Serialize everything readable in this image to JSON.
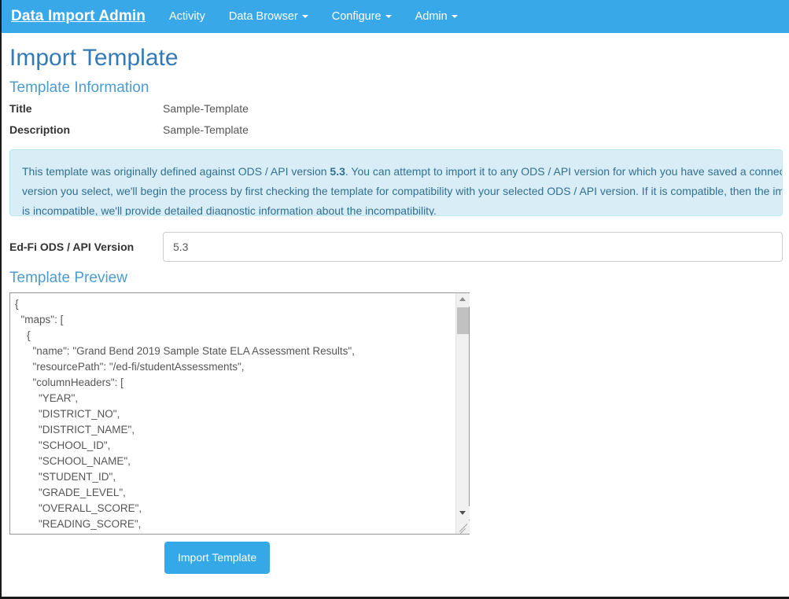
{
  "navbar": {
    "brand": "Data Import Admin",
    "items": [
      {
        "label": "Activity",
        "has_caret": false
      },
      {
        "label": "Data Browser",
        "has_caret": true
      },
      {
        "label": "Configure",
        "has_caret": true
      },
      {
        "label": "Admin",
        "has_caret": true
      }
    ]
  },
  "page": {
    "title": "Import Template",
    "section_template_information": "Template Information",
    "section_template_preview": "Template Preview"
  },
  "template_information": {
    "title_label": "Title",
    "title_value": "Sample-Template",
    "description_label": "Description",
    "description_value": "Sample-Template"
  },
  "alert": {
    "line1_pre": "This template was originally defined against ODS / API version ",
    "line1_version": "5.3",
    "line1_post": ". You can attempt to import it to any ODS / API version for which you have saved a connection. Whatever",
    "line2": "version you select, we'll begin the process by first checking the template for compatibility with your selected ODS / API version. If it is compatible, then the import will proceed. If it",
    "line3": "is incompatible, we'll provide detailed diagnostic information about the incompatibility."
  },
  "version_field": {
    "label": "Ed-Fi ODS / API Version",
    "value": "5.3",
    "options": [
      "5.3"
    ]
  },
  "preview": {
    "content": "{\n  \"maps\": [\n    {\n      \"name\": \"Grand Bend 2019 Sample State ELA Assessment Results\",\n      \"resourcePath\": \"/ed-fi/studentAssessments\",\n      \"columnHeaders\": [\n        \"YEAR\",\n        \"DISTRICT_NO\",\n        \"DISTRICT_NAME\",\n        \"SCHOOL_ID\",\n        \"SCHOOL_NAME\",\n        \"STUDENT_ID\",\n        \"GRADE_LEVEL\",\n        \"OVERALL_SCORE\",\n        \"READING_SCORE\","
  },
  "actions": {
    "import_button": "Import Template"
  },
  "colors": {
    "navbar": "#39a8e8",
    "primary_button": "#35a8e8",
    "heading": "#337ab7",
    "subheading": "#4c9ccf",
    "alert_bg": "#d9edf7",
    "alert_border": "#bce8f1",
    "alert_text": "#31708f"
  }
}
